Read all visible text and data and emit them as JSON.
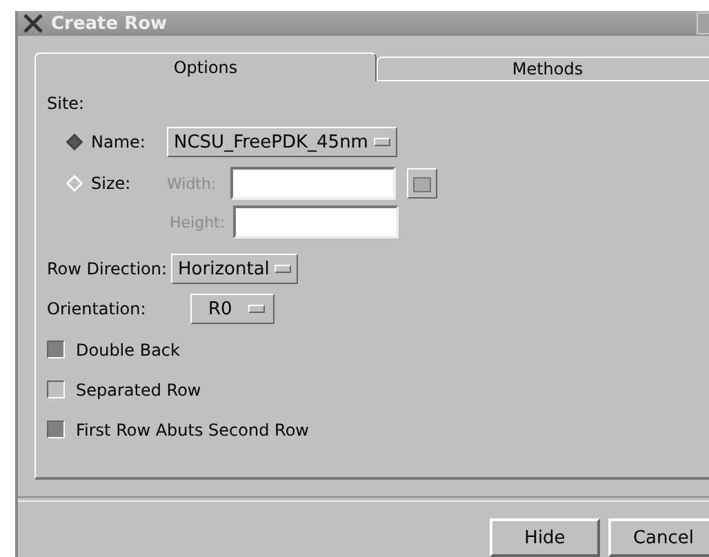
{
  "window": {
    "title": "Create Row"
  },
  "tabs": [
    {
      "label": "Options",
      "selected": true
    },
    {
      "label": "Methods",
      "selected": false
    }
  ],
  "site": {
    "label": "Site:",
    "options": [
      {
        "label": "Name:",
        "selected": true
      },
      {
        "label": "Size:",
        "selected": false
      }
    ],
    "name_value": "NCSU_FreePDK_45nm",
    "width": {
      "label": "Width:",
      "disabled": true
    },
    "height": {
      "label": "Height:",
      "disabled": true
    }
  },
  "row_direction": {
    "label": "Row Direction:",
    "value": "Horizontal"
  },
  "orientation": {
    "label": "Orientation:",
    "value": "R0"
  },
  "checkboxes": [
    {
      "label": "Double Back",
      "checked": true
    },
    {
      "label": "Separated Row",
      "checked": false
    },
    {
      "label": "First Row Abuts Second Row",
      "checked": true
    }
  ],
  "buttons": [
    "Hide",
    "Cancel"
  ]
}
